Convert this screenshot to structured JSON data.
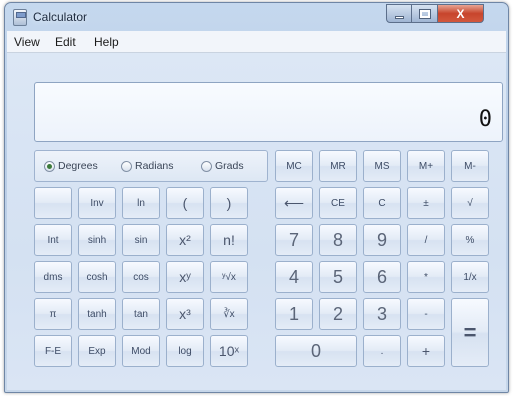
{
  "window": {
    "title": "Calculator",
    "close_glyph": "X"
  },
  "menu": {
    "view": "View",
    "edit": "Edit",
    "help": "Help"
  },
  "display": {
    "value": "0"
  },
  "angle_units": {
    "options": [
      "Degrees",
      "Radians",
      "Grads"
    ],
    "selected": "Degrees"
  },
  "keys": {
    "mc": "MC",
    "mr": "MR",
    "ms": "MS",
    "mplus": "M+",
    "mminus": "M-",
    "blank": "",
    "inv": "Inv",
    "ln": "ln",
    "lparen": "(",
    "rparen": ")",
    "backspace": "⟵",
    "ce": "CE",
    "c": "C",
    "plusminus": "±",
    "sqrt": "√",
    "int": "Int",
    "sinh": "sinh",
    "sin": "sin",
    "x2": "x²",
    "nfact": "n!",
    "n7": "7",
    "n8": "8",
    "n9": "9",
    "div": "/",
    "percent": "%",
    "dms": "dms",
    "cosh": "cosh",
    "cos": "cos",
    "xy": "xʸ",
    "yroot": "ʸ√x",
    "n4": "4",
    "n5": "5",
    "n6": "6",
    "mul": "*",
    "recip": "1/x",
    "pi": "π",
    "tanh": "tanh",
    "tan": "tan",
    "x3": "x³",
    "cbrt": "∛x",
    "n1": "1",
    "n2": "2",
    "n3": "3",
    "minus": "-",
    "equals": "=",
    "fe": "F-E",
    "exp": "Exp",
    "mod": "Mod",
    "log": "log",
    "tenx": "10ˣ",
    "n0": "0",
    "dot": ".",
    "plus": "+"
  }
}
